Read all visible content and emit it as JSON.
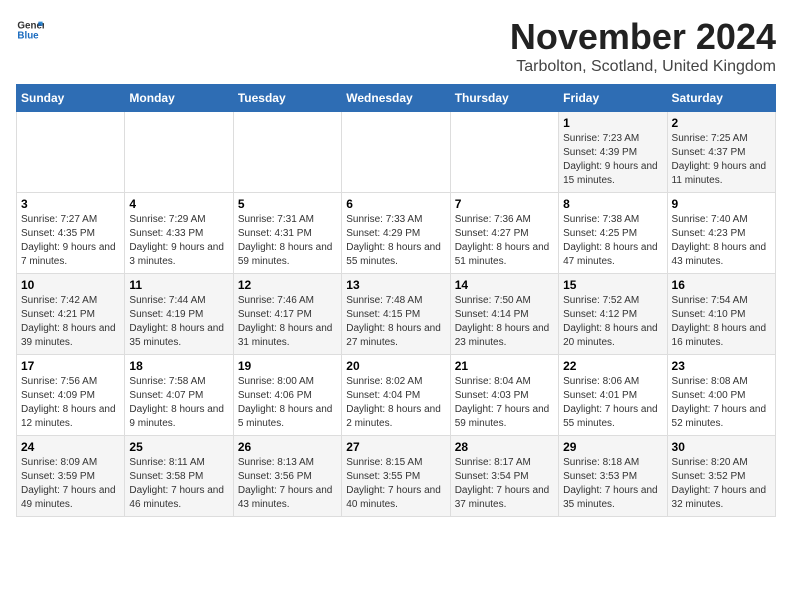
{
  "logo": {
    "text_general": "General",
    "text_blue": "Blue"
  },
  "title": "November 2024",
  "subtitle": "Tarbolton, Scotland, United Kingdom",
  "days_of_week": [
    "Sunday",
    "Monday",
    "Tuesday",
    "Wednesday",
    "Thursday",
    "Friday",
    "Saturday"
  ],
  "weeks": [
    [
      {
        "day": "",
        "info": ""
      },
      {
        "day": "",
        "info": ""
      },
      {
        "day": "",
        "info": ""
      },
      {
        "day": "",
        "info": ""
      },
      {
        "day": "",
        "info": ""
      },
      {
        "day": "1",
        "info": "Sunrise: 7:23 AM\nSunset: 4:39 PM\nDaylight: 9 hours and 15 minutes."
      },
      {
        "day": "2",
        "info": "Sunrise: 7:25 AM\nSunset: 4:37 PM\nDaylight: 9 hours and 11 minutes."
      }
    ],
    [
      {
        "day": "3",
        "info": "Sunrise: 7:27 AM\nSunset: 4:35 PM\nDaylight: 9 hours and 7 minutes."
      },
      {
        "day": "4",
        "info": "Sunrise: 7:29 AM\nSunset: 4:33 PM\nDaylight: 9 hours and 3 minutes."
      },
      {
        "day": "5",
        "info": "Sunrise: 7:31 AM\nSunset: 4:31 PM\nDaylight: 8 hours and 59 minutes."
      },
      {
        "day": "6",
        "info": "Sunrise: 7:33 AM\nSunset: 4:29 PM\nDaylight: 8 hours and 55 minutes."
      },
      {
        "day": "7",
        "info": "Sunrise: 7:36 AM\nSunset: 4:27 PM\nDaylight: 8 hours and 51 minutes."
      },
      {
        "day": "8",
        "info": "Sunrise: 7:38 AM\nSunset: 4:25 PM\nDaylight: 8 hours and 47 minutes."
      },
      {
        "day": "9",
        "info": "Sunrise: 7:40 AM\nSunset: 4:23 PM\nDaylight: 8 hours and 43 minutes."
      }
    ],
    [
      {
        "day": "10",
        "info": "Sunrise: 7:42 AM\nSunset: 4:21 PM\nDaylight: 8 hours and 39 minutes."
      },
      {
        "day": "11",
        "info": "Sunrise: 7:44 AM\nSunset: 4:19 PM\nDaylight: 8 hours and 35 minutes."
      },
      {
        "day": "12",
        "info": "Sunrise: 7:46 AM\nSunset: 4:17 PM\nDaylight: 8 hours and 31 minutes."
      },
      {
        "day": "13",
        "info": "Sunrise: 7:48 AM\nSunset: 4:15 PM\nDaylight: 8 hours and 27 minutes."
      },
      {
        "day": "14",
        "info": "Sunrise: 7:50 AM\nSunset: 4:14 PM\nDaylight: 8 hours and 23 minutes."
      },
      {
        "day": "15",
        "info": "Sunrise: 7:52 AM\nSunset: 4:12 PM\nDaylight: 8 hours and 20 minutes."
      },
      {
        "day": "16",
        "info": "Sunrise: 7:54 AM\nSunset: 4:10 PM\nDaylight: 8 hours and 16 minutes."
      }
    ],
    [
      {
        "day": "17",
        "info": "Sunrise: 7:56 AM\nSunset: 4:09 PM\nDaylight: 8 hours and 12 minutes."
      },
      {
        "day": "18",
        "info": "Sunrise: 7:58 AM\nSunset: 4:07 PM\nDaylight: 8 hours and 9 minutes."
      },
      {
        "day": "19",
        "info": "Sunrise: 8:00 AM\nSunset: 4:06 PM\nDaylight: 8 hours and 5 minutes."
      },
      {
        "day": "20",
        "info": "Sunrise: 8:02 AM\nSunset: 4:04 PM\nDaylight: 8 hours and 2 minutes."
      },
      {
        "day": "21",
        "info": "Sunrise: 8:04 AM\nSunset: 4:03 PM\nDaylight: 7 hours and 59 minutes."
      },
      {
        "day": "22",
        "info": "Sunrise: 8:06 AM\nSunset: 4:01 PM\nDaylight: 7 hours and 55 minutes."
      },
      {
        "day": "23",
        "info": "Sunrise: 8:08 AM\nSunset: 4:00 PM\nDaylight: 7 hours and 52 minutes."
      }
    ],
    [
      {
        "day": "24",
        "info": "Sunrise: 8:09 AM\nSunset: 3:59 PM\nDaylight: 7 hours and 49 minutes."
      },
      {
        "day": "25",
        "info": "Sunrise: 8:11 AM\nSunset: 3:58 PM\nDaylight: 7 hours and 46 minutes."
      },
      {
        "day": "26",
        "info": "Sunrise: 8:13 AM\nSunset: 3:56 PM\nDaylight: 7 hours and 43 minutes."
      },
      {
        "day": "27",
        "info": "Sunrise: 8:15 AM\nSunset: 3:55 PM\nDaylight: 7 hours and 40 minutes."
      },
      {
        "day": "28",
        "info": "Sunrise: 8:17 AM\nSunset: 3:54 PM\nDaylight: 7 hours and 37 minutes."
      },
      {
        "day": "29",
        "info": "Sunrise: 8:18 AM\nSunset: 3:53 PM\nDaylight: 7 hours and 35 minutes."
      },
      {
        "day": "30",
        "info": "Sunrise: 8:20 AM\nSunset: 3:52 PM\nDaylight: 7 hours and 32 minutes."
      }
    ]
  ]
}
